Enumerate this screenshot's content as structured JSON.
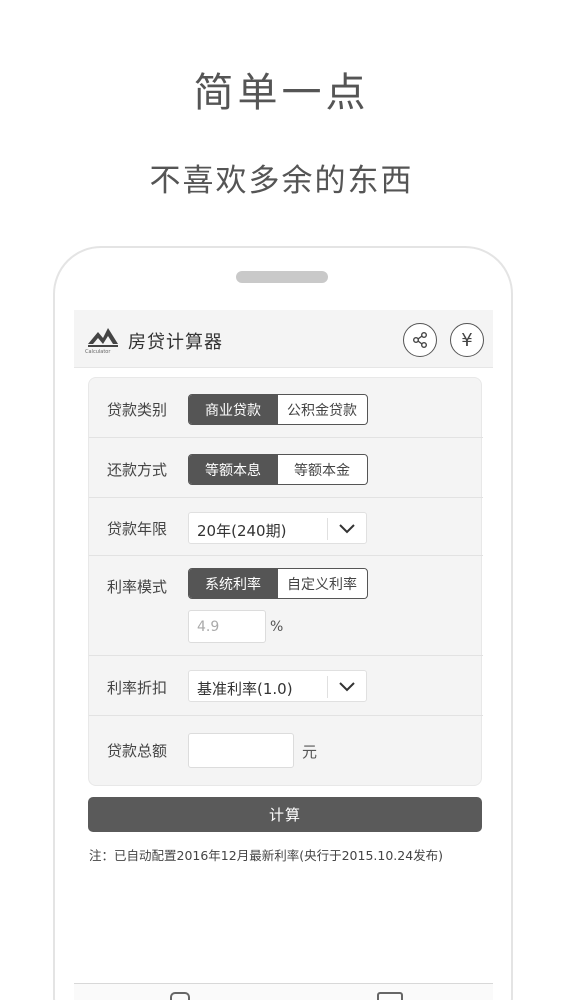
{
  "promo": {
    "headline": "简单一点",
    "subline": "不喜欢多余的东西"
  },
  "app": {
    "title": "房贷计算器",
    "logo_caption": "Calculator",
    "share_icon": "share-icon",
    "yen_icon": "¥"
  },
  "form": {
    "loan_type": {
      "label": "贷款类别",
      "options": [
        "商业贷款",
        "公积金贷款"
      ],
      "selected": "商业贷款"
    },
    "repay_method": {
      "label": "还款方式",
      "options": [
        "等额本息",
        "等额本金"
      ],
      "selected": "等额本息"
    },
    "term": {
      "label": "贷款年限",
      "value": "20年(240期)"
    },
    "rate_mode": {
      "label": "利率模式",
      "options": [
        "系统利率",
        "自定义利率"
      ],
      "selected": "系统利率",
      "rate_value": "4.9",
      "rate_unit": "%"
    },
    "discount": {
      "label": "利率折扣",
      "value": "基准利率(1.0)"
    },
    "amount": {
      "label": "贷款总额",
      "value": "",
      "unit": "元"
    }
  },
  "calc_button": "计算",
  "note": "注：已自动配置2016年12月最新利率(央行于2015.10.24发布)",
  "colors": {
    "accent": "#555555",
    "card_bg": "#f4f4f4"
  }
}
